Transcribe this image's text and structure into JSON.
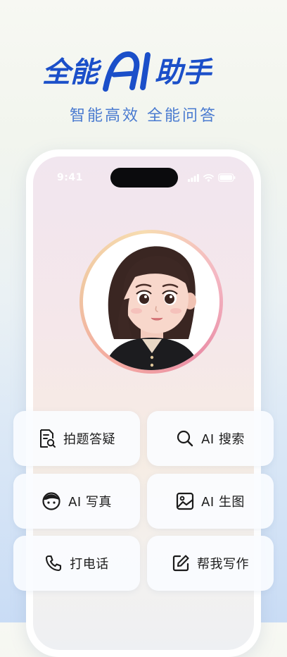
{
  "hero": {
    "title_prefix": "全能",
    "title_logo": "AI",
    "title_suffix": "助手",
    "subtitle": "智能高效 全能问答"
  },
  "phone": {
    "status_time": "9:41"
  },
  "actions": [
    {
      "label": "拍题答疑",
      "icon": "photo-question-icon"
    },
    {
      "label": "AI 搜索",
      "icon": "search-icon"
    },
    {
      "label": "AI 写真",
      "icon": "face-icon"
    },
    {
      "label": "AI 生图",
      "icon": "image-icon"
    },
    {
      "label": "打电话",
      "icon": "phone-icon"
    },
    {
      "label": "帮我写作",
      "icon": "edit-icon"
    }
  ],
  "colors": {
    "brand": "#1b4fc9",
    "subtitle": "#4a7bd0"
  }
}
